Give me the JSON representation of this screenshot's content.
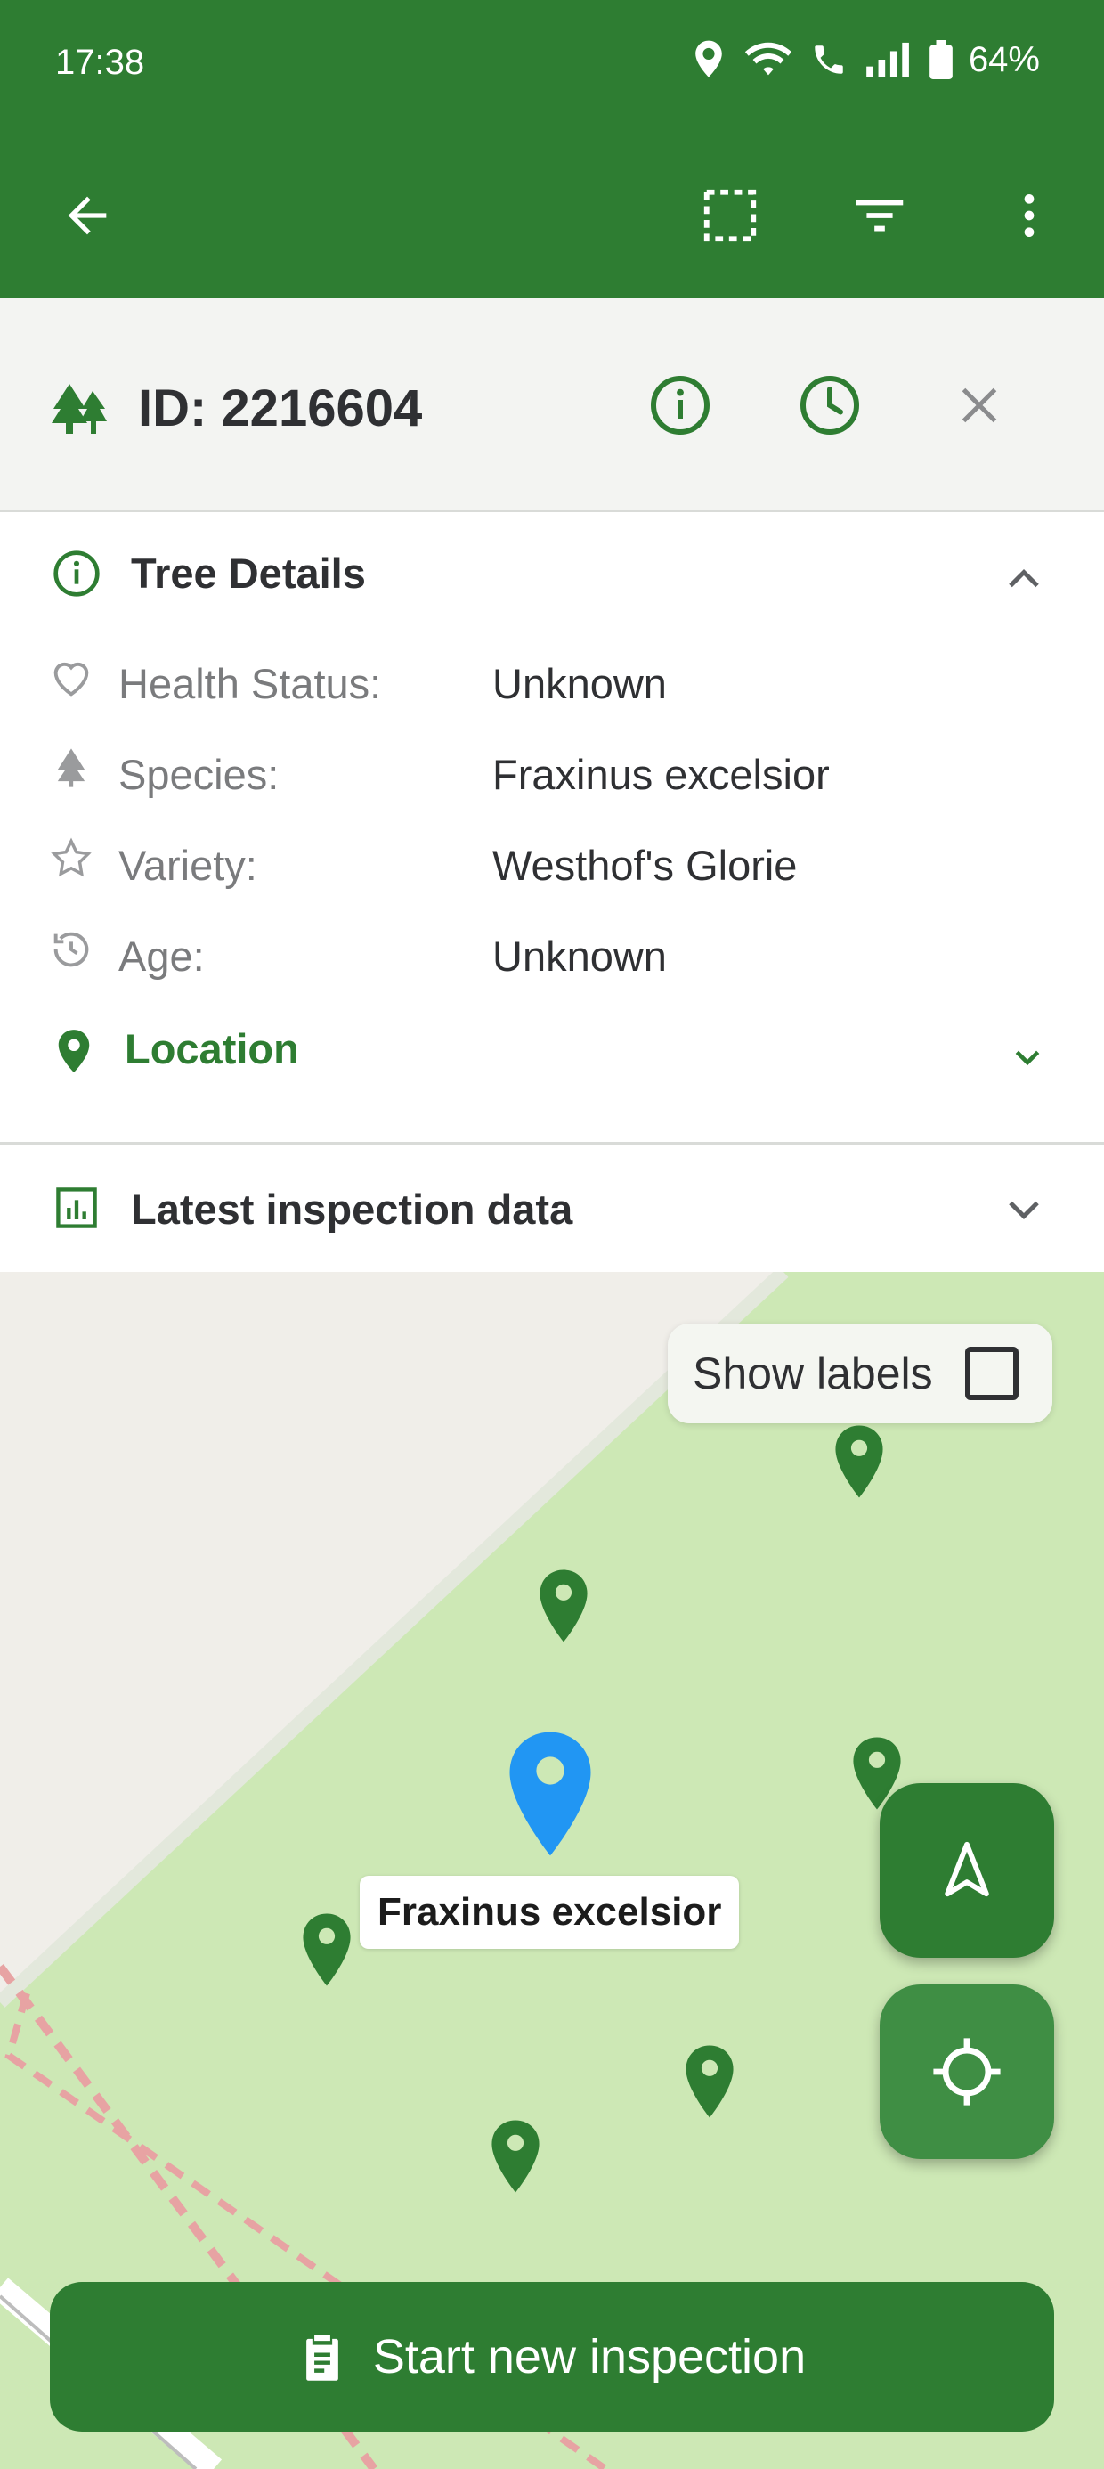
{
  "status_bar": {
    "time": "17:38",
    "battery": "64%"
  },
  "header": {
    "tree_id": "ID: 2216604"
  },
  "tree_details": {
    "title": "Tree Details",
    "rows": [
      {
        "label": "Health Status:",
        "value": "Unknown",
        "icon": "heart-icon"
      },
      {
        "label": "Species:",
        "value": "Fraxinus excelsior",
        "icon": "tree-icon"
      },
      {
        "label": "Variety:",
        "value": "Westhof's Glorie",
        "icon": "star-icon"
      },
      {
        "label": "Age:",
        "value": "Unknown",
        "icon": "history-icon"
      }
    ],
    "location_label": "Location"
  },
  "inspection": {
    "title": "Latest inspection data"
  },
  "map": {
    "show_labels": "Show labels",
    "selected_label": "Fraxinus excelsior"
  },
  "actions": {
    "start_inspection": "Start new inspection"
  },
  "colors": {
    "primary": "#2e7d32",
    "selected_pin": "#2196f3",
    "map_green": "#cde8b5"
  }
}
